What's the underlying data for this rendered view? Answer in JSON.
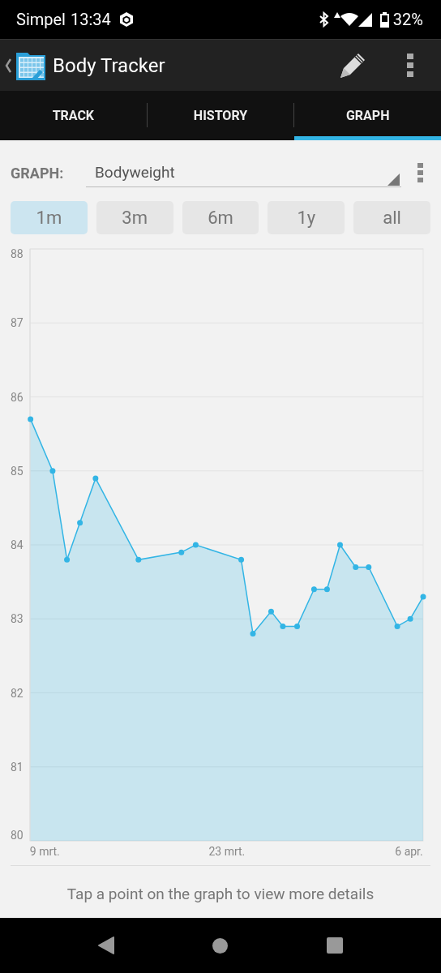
{
  "status_bar": {
    "carrier": "Simpel",
    "time": "13:34",
    "battery": "32%"
  },
  "app_bar": {
    "title": "Body Tracker"
  },
  "tabs": [
    {
      "label": "TRACK",
      "selected": false
    },
    {
      "label": "HISTORY",
      "selected": false
    },
    {
      "label": "GRAPH",
      "selected": true
    }
  ],
  "graph_selector": {
    "label": "GRAPH:",
    "value": "Bodyweight"
  },
  "ranges": [
    {
      "label": "1m",
      "selected": true
    },
    {
      "label": "3m",
      "selected": false
    },
    {
      "label": "6m",
      "selected": false
    },
    {
      "label": "1y",
      "selected": false
    },
    {
      "label": "all",
      "selected": false
    }
  ],
  "chart_data": {
    "type": "area",
    "x": [
      7.9,
      9.6,
      10.7,
      11.7,
      12.9,
      16.2,
      19.5,
      20.6,
      24.1,
      25.0,
      26.4,
      27.3,
      28.4,
      29.7,
      30.7,
      31.7,
      32.9,
      33.9,
      36.1,
      37.1,
      38.09
    ],
    "grid": true,
    "series": [
      {
        "color": "#33b5e5",
        "values": [
          85.7,
          85.0,
          83.8,
          84.3,
          84.9,
          83.8,
          83.9,
          84.0,
          83.8,
          82.8,
          83.1,
          82.9,
          82.9,
          83.4,
          83.4,
          84.0,
          83.7,
          83.7,
          82.9,
          83.0,
          83.3
        ]
      }
    ],
    "xlim": [
      7.86,
      38.09
    ],
    "ylim": [
      80,
      88
    ],
    "xticks": [
      {
        "value": 9,
        "label": "9 mrt."
      },
      {
        "value": 23,
        "label": "23 mrt."
      },
      {
        "value": 37,
        "label": "6 apr."
      }
    ],
    "yticks": [
      80,
      81,
      82,
      83,
      84,
      85,
      86,
      87,
      88
    ]
  },
  "hint": "Tap a point on the graph to view more details"
}
